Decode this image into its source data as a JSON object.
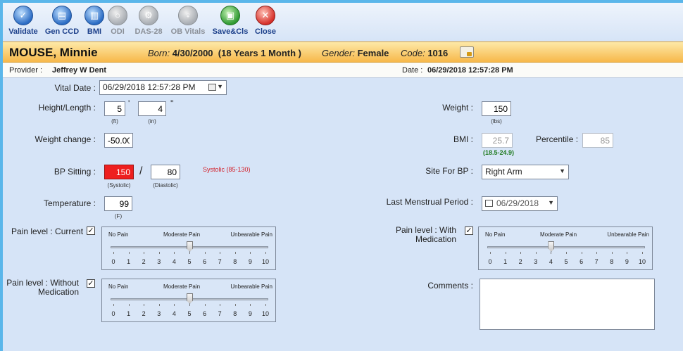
{
  "toolbar": {
    "buttons": [
      {
        "label": "Validate",
        "icon": "validate-icon",
        "enabled": true
      },
      {
        "label": "Gen CCD",
        "icon": "gen-ccd-icon",
        "enabled": true
      },
      {
        "label": "BMI",
        "icon": "bmi-icon",
        "enabled": true
      },
      {
        "label": "ODI",
        "icon": "odi-icon",
        "enabled": false
      },
      {
        "label": "DAS-28",
        "icon": "das28-icon",
        "enabled": false
      },
      {
        "label": "OB Vitals",
        "icon": "ob-vitals-icon",
        "enabled": false
      },
      {
        "label": "Save&Cls",
        "icon": "save-icon",
        "enabled": true
      },
      {
        "label": "Close",
        "icon": "close-icon",
        "enabled": true
      }
    ]
  },
  "patient": {
    "name": "MOUSE, Minnie",
    "born_label": "Born:",
    "born_value": "4/30/2000  (18 Years 1 Month )",
    "gender_label": "Gender:",
    "gender_value": "Female",
    "code_label": "Code:",
    "code_value": "1016"
  },
  "provider": {
    "label": "Provider :",
    "value": "Jeffrey W Dent",
    "date_label": "Date :",
    "date_value": "06/29/2018 12:57:28 PM"
  },
  "form": {
    "vital_date": {
      "label": "Vital Date :",
      "value": "06/29/2018 12:57:28 PM"
    },
    "height": {
      "label": "Height/Length :",
      "feet": "5",
      "inches": "4",
      "feet_mark": "'",
      "inch_mark": "''",
      "feet_unit": "(ft)",
      "inch_unit": "(in)"
    },
    "weight": {
      "label": "Weight :",
      "value": "150",
      "unit": "(lbs)"
    },
    "weight_change": {
      "label": "Weight change :",
      "value": "-50.00"
    },
    "bmi": {
      "label": "BMI :",
      "value": "25.7",
      "range": "(18.5-24.9)"
    },
    "percentile": {
      "label": "Percentile :",
      "value": "85"
    },
    "bp_sitting": {
      "label": "BP Sitting :",
      "systolic": "150",
      "diastolic": "80",
      "separator": "/",
      "systolic_unit": "(Systolic)",
      "diastolic_unit": "(Diastolic)",
      "warning": "Systolic (85-130)"
    },
    "site_for_bp": {
      "label": "Site For BP :",
      "value": "Right Arm"
    },
    "temperature": {
      "label": "Temperature :",
      "value": "99",
      "unit": "(F)"
    },
    "last_menstrual": {
      "label": "Last Menstrual Period :",
      "value": "06/29/2018"
    },
    "pain_current": {
      "label": "Pain level : Current",
      "checked": true,
      "level": 5
    },
    "pain_with_med": {
      "label_line1": "Pain level : With",
      "label_line2": "Medication",
      "checked": true,
      "level": 4
    },
    "pain_without_med": {
      "label_line1": "Pain level : Without",
      "label_line2": "Medication",
      "checked": true,
      "level": 5
    },
    "pain_scale": {
      "no_pain": "No Pain",
      "moderate": "Moderate Pain",
      "unbearable": "Unbearable Pain",
      "numbers": [
        "0",
        "1",
        "2",
        "3",
        "4",
        "5",
        "6",
        "7",
        "8",
        "9",
        "10"
      ]
    },
    "comments": {
      "label": "Comments :",
      "value": ""
    }
  },
  "colors": {
    "accent": "#f7b84a",
    "background": "#d6e4f7",
    "alert": "#ee1f1f",
    "bmi_range": "#1f7a1f",
    "warning_text": "#d3212b"
  }
}
